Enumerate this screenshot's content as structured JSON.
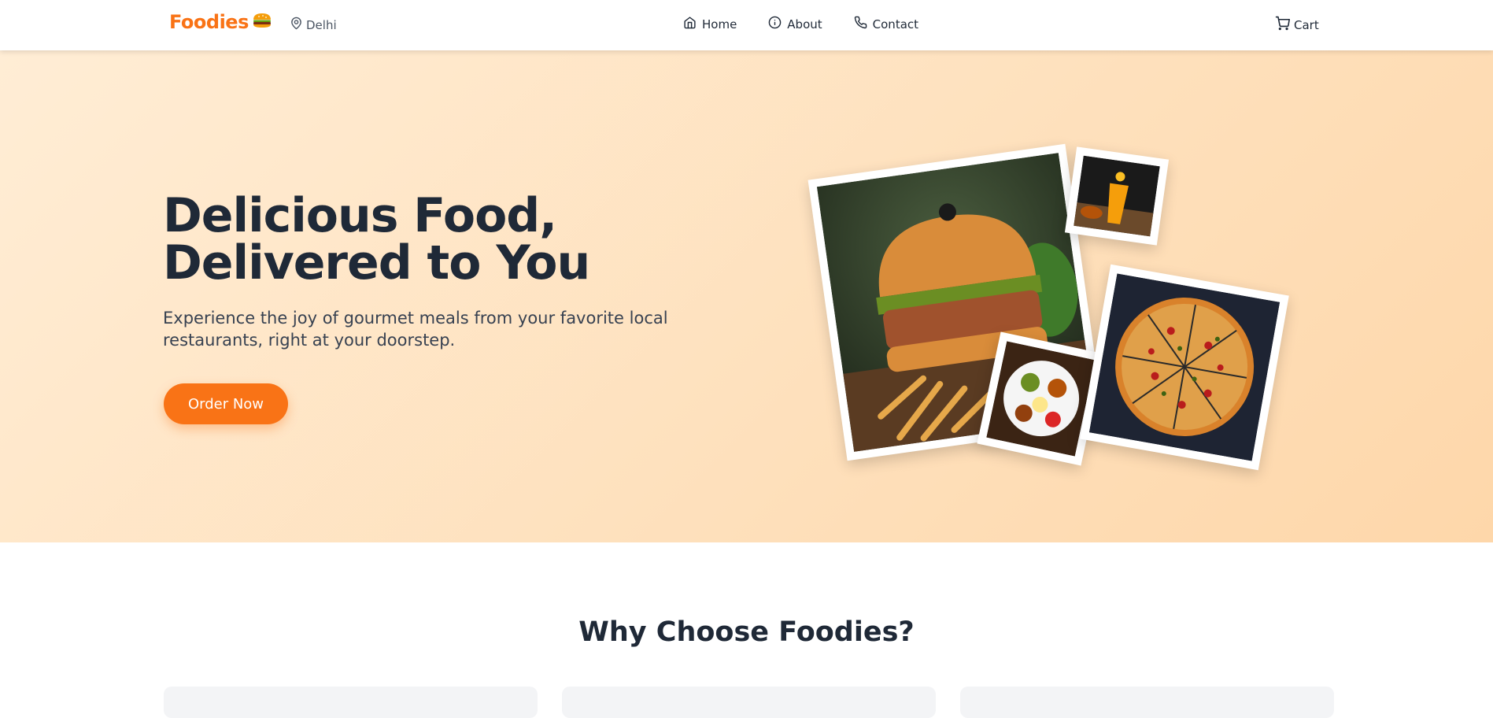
{
  "navbar": {
    "brand": "Foodies",
    "location": "Delhi",
    "links": [
      {
        "label": "Home",
        "icon": "home-icon"
      },
      {
        "label": "About",
        "icon": "info-icon"
      },
      {
        "label": "Contact",
        "icon": "phone-icon"
      }
    ],
    "cart_label": "Cart"
  },
  "hero": {
    "title_line1": "Delicious Food,",
    "title_line2": "Delivered to You",
    "subtitle": "Experience the joy of gourmet meals from your favorite local restaurants, right at your doorstep.",
    "cta_label": "Order Now"
  },
  "why": {
    "title": "Why Choose Foodies?"
  },
  "colors": {
    "accent": "#f97316",
    "hero_bg_start": "#ffedd5",
    "hero_bg_end": "#fed7aa",
    "text_dark": "#1f2937"
  }
}
